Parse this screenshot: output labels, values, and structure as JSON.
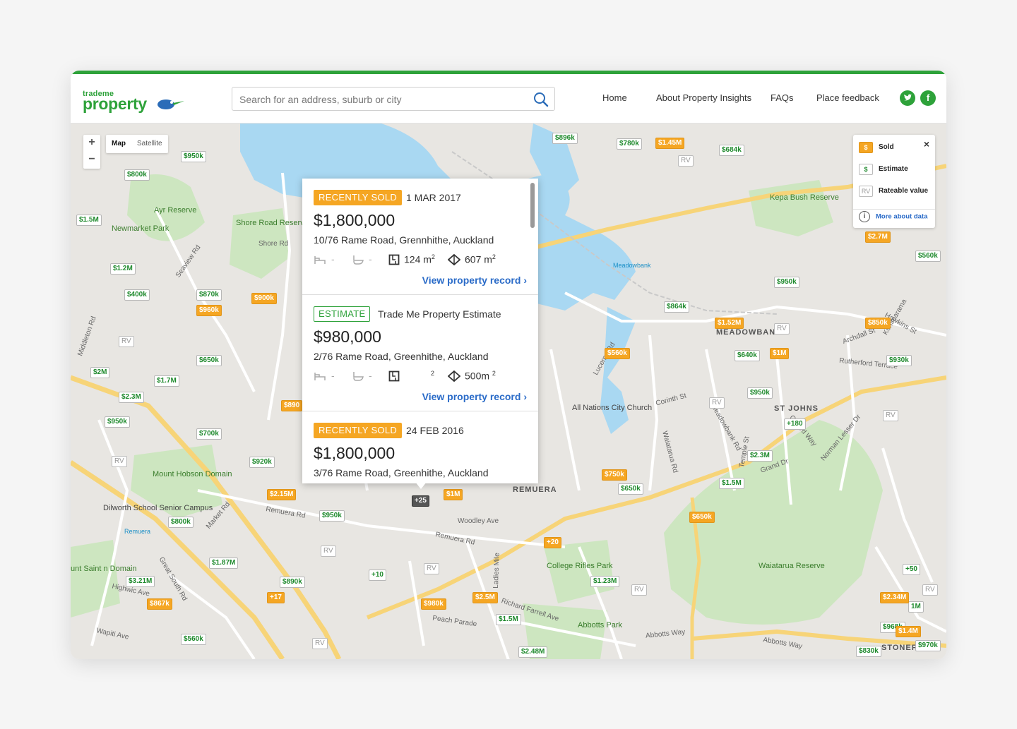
{
  "header": {
    "logo_small": "trademe",
    "logo_big": "property",
    "search_placeholder": "Search for an address, suburb or city",
    "nav": [
      "Home",
      "About Property Insights",
      "FAQs",
      "Place feedback"
    ],
    "social": [
      "twitter-icon",
      "facebook-icon"
    ]
  },
  "colors": {
    "brand_green": "#2ea23a",
    "sold_orange": "#f5a623",
    "link_blue": "#2a6bc8"
  },
  "map_controls": {
    "zoom_in": "+",
    "zoom_out": "−",
    "map": "Map",
    "satellite": "Satellite"
  },
  "legend": {
    "close": "×",
    "items": [
      {
        "symbol": "$",
        "label": "Sold"
      },
      {
        "symbol": "$",
        "label": "Estimate"
      },
      {
        "symbol": "RV",
        "label": "Rateable value"
      }
    ],
    "info": "i",
    "more": "More about data"
  },
  "popup": {
    "cards": [
      {
        "badge": "RECENTLY SOLD",
        "date": "1 MAR 2017",
        "price": "$1,800,000",
        "address": "10/76 Rame Road, Grennhithe, Auckland",
        "beds": "-",
        "baths": "-",
        "floor": "124 m",
        "land": "607 m",
        "link": "View property record"
      },
      {
        "badge": "ESTIMATE",
        "date": "Trade Me Property Estimate",
        "price": "$980,000",
        "address": "2/76 Rame Road, Greenhithe, Auckland",
        "beds": "-",
        "baths": "-",
        "floor": "",
        "land": "500m",
        "link": "View property record"
      },
      {
        "badge": "RECENTLY SOLD",
        "date": "24 FEB 2016",
        "price": "$1,800,000",
        "address": "3/76 Rame Road, Greenhithe, Auckland"
      }
    ],
    "sup": "2"
  },
  "pins": {
    "est": [
      "$950k",
      "$800k",
      "$1.5M",
      "$1.2M",
      "$400k",
      "$870k",
      "$650k",
      "$1.7M",
      "$2M",
      "$2.3M",
      "$950k",
      "$700k",
      "$920k",
      "$800k",
      "$950k",
      "$1.87M",
      "$3.21M",
      "$890k",
      "+10",
      "$560k",
      "$896k",
      "$780k",
      "$684k",
      "$560k",
      "$950k",
      "$864k",
      "$640k",
      "$930k",
      "$950k",
      "+180",
      "$2.3M",
      "$1.5M",
      "$650k",
      "$1.23M",
      "$1.5M",
      "$2.48M",
      "+50",
      "1M",
      "$968k",
      "$830k",
      "$970k"
    ],
    "sold": [
      "$900k",
      "$960k",
      "$890",
      "$2.15M",
      "$1M",
      "+17",
      "$867k",
      "$980k",
      "$2.5M",
      "+20",
      "$750k",
      "$1.45M",
      "$2.7M",
      "$1.52M",
      "$850k",
      "$1M",
      "$560k",
      "$650k",
      "$2.34M",
      "$1.4M"
    ],
    "cluster": "+25",
    "rv": "RV"
  },
  "map_labels": {
    "parks": [
      "Ayr Reserve",
      "Newmarket Park",
      "Shore Road Reserve",
      "Mount Hobson Domain",
      "Kepa Bush Reserve",
      "College Rifles Park",
      "Abbotts Park",
      "Waiatarua Reserve",
      "unt Saint n Domain"
    ],
    "suburbs": [
      "MEADOWBANK",
      "ST JOHNS",
      "REMUERA",
      "STONEFIE"
    ],
    "pois": [
      "Dilworth School Senior Campus",
      "All Nations City Church",
      "Meadowbank",
      "Remuera"
    ],
    "streets": [
      "Shore Rd",
      "Remuera Rd",
      "Remuera Rd",
      "Peach Parade",
      "Abbotts Way",
      "Abbotts Way",
      "Woodley Ave",
      "Rutherford Terrace",
      "Highwic Ave",
      "Wapiti Ave",
      "Kohimarama",
      "Hawkins St",
      "Archdall St",
      "Middleton Rd",
      "Seaview Rd",
      "Market Rd",
      "Great South Rd",
      "Ladies Mile",
      "Richard Farrell Ave",
      "Meadowbank Rd",
      "Temple St",
      "Grand Dr",
      "Lucerne Rd",
      "Corinth St",
      "Waiatarua Rd",
      "Norman Lesser Dr",
      "Gerard Way"
    ]
  }
}
